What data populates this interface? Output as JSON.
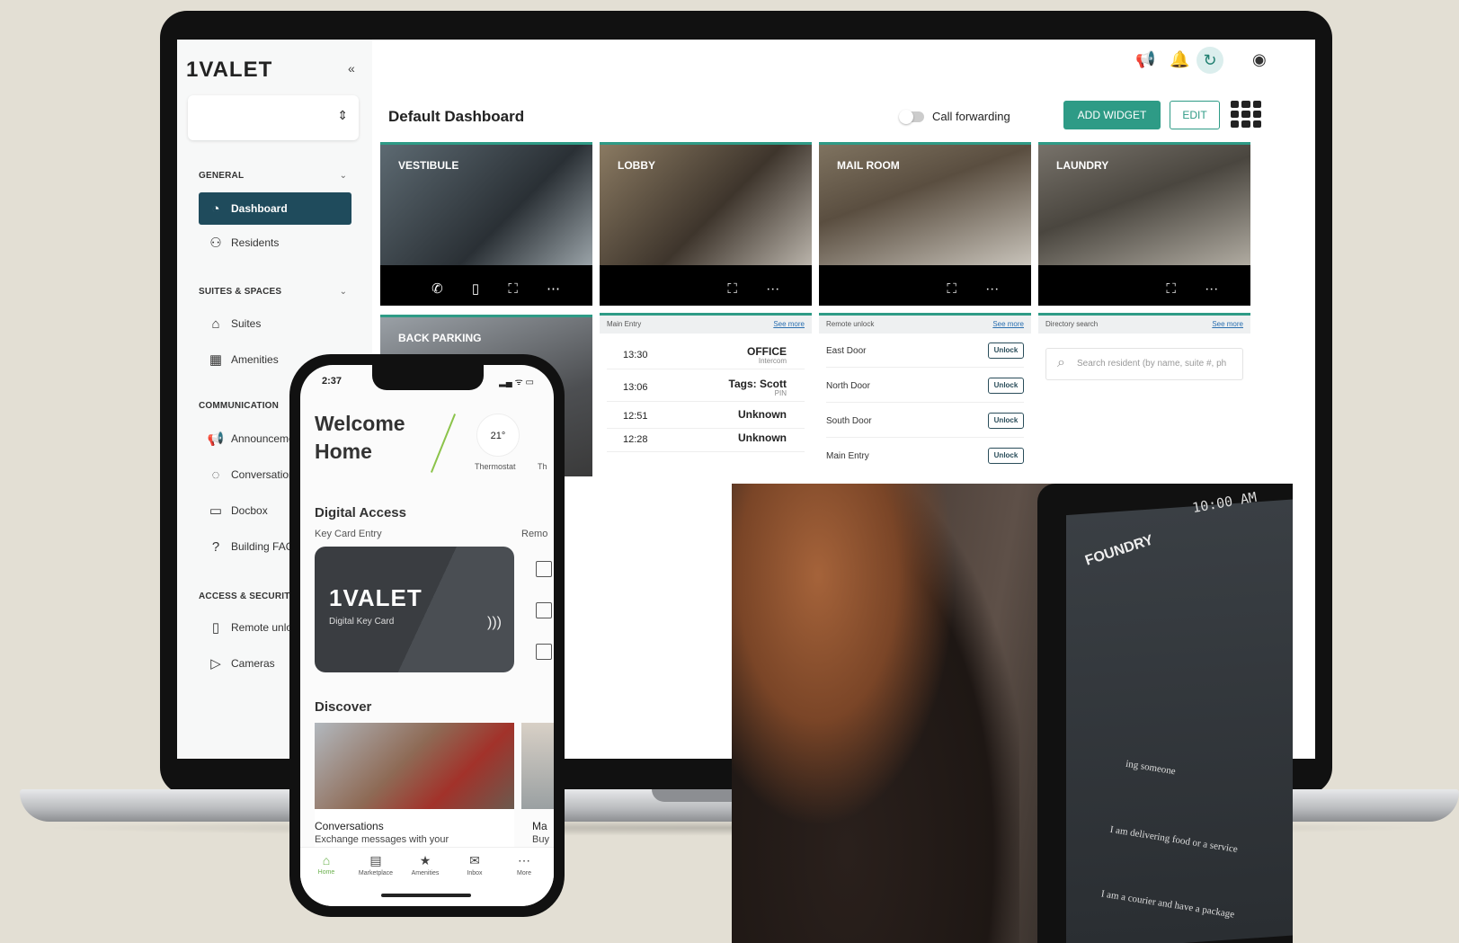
{
  "web": {
    "logo": "1VALET",
    "collapse_icon": "«",
    "property_select_icon": "⇕",
    "sections": [
      {
        "label": "GENERAL",
        "items": [
          {
            "label": "Dashboard",
            "icon": "◔"
          },
          {
            "label": "Residents",
            "icon": "⚇"
          }
        ]
      },
      {
        "label": "SUITES & SPACES",
        "items": [
          {
            "label": "Suites",
            "icon": "⌂"
          },
          {
            "label": "Amenities",
            "icon": "▦"
          }
        ]
      },
      {
        "label": "COMMUNICATION",
        "items": [
          {
            "label": "Announcemen",
            "icon": "📢"
          },
          {
            "label": "Conversation",
            "icon": "◌"
          },
          {
            "label": "Docbox",
            "icon": "▭"
          },
          {
            "label": "Building FAQs",
            "icon": "?"
          }
        ]
      },
      {
        "label": "ACCESS & SECURITY",
        "items": [
          {
            "label": "Remote unloc",
            "icon": "▯"
          },
          {
            "label": "Cameras",
            "icon": "▷"
          }
        ]
      }
    ],
    "dashboard_title": "Default Dashboard",
    "call_forwarding": "Call forwarding",
    "add_widget": "ADD WIDGET",
    "edit": "EDIT",
    "cameras": [
      {
        "name": "VESTIBULE",
        "controls": "✆ ▯ ⛶ ⋯",
        "tint": "#5d6a72"
      },
      {
        "name": "LOBBY",
        "controls": "⛶ ⋯",
        "tint": "#8a7a62"
      },
      {
        "name": "MAIL ROOM",
        "controls": "⛶ ⋯",
        "tint": "#7f7360"
      },
      {
        "name": "LAUNDRY",
        "controls": "⛶ ⋯",
        "tint": "#77726a"
      }
    ],
    "back_parking": "BACK PARKING",
    "main_entry": {
      "title": "Main Entry",
      "see_more": "See more",
      "rows": [
        {
          "time": "13:30",
          "value": "OFFICE",
          "sub": "Intercom"
        },
        {
          "time": "13:06",
          "value": "Tags: Scott",
          "sub": "PIN"
        },
        {
          "time": "12:51",
          "value": "Unknown",
          "sub": ""
        },
        {
          "time": "12:28",
          "value": "Unknown",
          "sub": ""
        }
      ]
    },
    "remote_unlock": {
      "title": "Remote unlock",
      "see_more": "See more",
      "button": "Unlock",
      "doors": [
        "East Door",
        "North Door",
        "South Door",
        "Main Entry"
      ]
    },
    "directory": {
      "title": "Directory search",
      "see_more": "See more",
      "placeholder": "Search resident (by name, suite #, ph"
    }
  },
  "phone": {
    "time": "2:37",
    "status": "▂▄ ᯤ ▭",
    "welcome": "Welcome Home",
    "temp": "21°",
    "thermostat": "Thermostat",
    "thermostat_cut": "Th",
    "digital_access": "Digital Access",
    "key_card_entry": "Key Card Entry",
    "remote_cut": "Remo",
    "card_logo": "1VALET",
    "card_label": "Digital Key Card",
    "discover": "Discover",
    "conv_title": "Conversations",
    "conv_desc": "Exchange messages with your",
    "second_title": "Ma",
    "second_desc": "Buy",
    "tabs": [
      {
        "label": "Home",
        "icon": "⌂",
        "active": true
      },
      {
        "label": "Marketplace",
        "icon": "▤",
        "active": false
      },
      {
        "label": "Amenities",
        "icon": "★",
        "active": false
      },
      {
        "label": "Inbox",
        "icon": "✉",
        "active": false
      },
      {
        "label": "More",
        "icon": "⋯",
        "active": false
      }
    ]
  },
  "kiosk": {
    "time": "10:00 AM",
    "brand": "FOUNDRY",
    "line1": "ing someone",
    "line2": "I am delivering food or a service",
    "line3": "I am a courier and have a package"
  }
}
